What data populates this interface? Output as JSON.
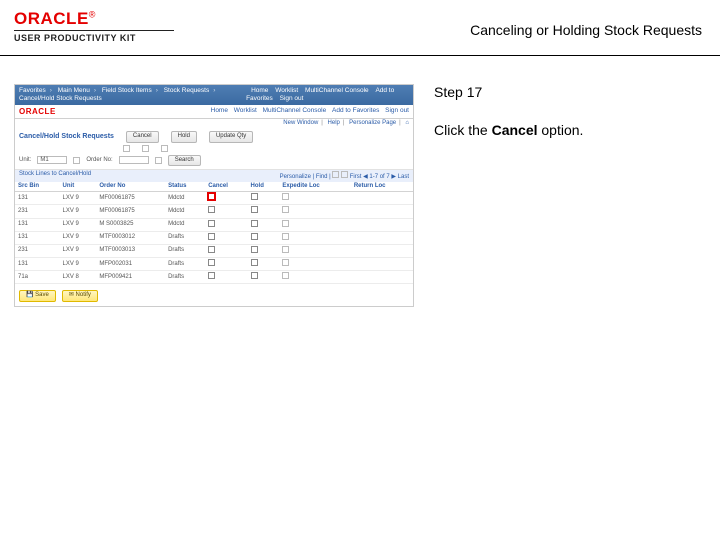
{
  "header": {
    "brand": "ORACLE",
    "brand_sub": "USER PRODUCTIVITY KIT",
    "doc_title": "Canceling or Holding Stock Requests"
  },
  "instructions": {
    "step_label": "Step 17",
    "line_pre": "Click the ",
    "line_bold": "Cancel",
    "line_post": " option."
  },
  "shot": {
    "crumb": {
      "items": [
        "Favorites",
        "Main Menu",
        "Field Stock Items",
        "Stock Requests",
        "Cancel/Hold Stock Requests"
      ],
      "right": [
        "Home",
        "Worklist",
        "MultiChannel Console",
        "Add to Favorites",
        "Sign out"
      ]
    },
    "mast": {
      "logo": "ORACLE",
      "links": [
        "Home",
        "Worklist",
        "MultiChannel Console",
        "Add to Favorites",
        "Sign out"
      ]
    },
    "util": [
      "New Window",
      "Help",
      "Personalize Page",
      "⌂"
    ],
    "page_title": "Cancel/Hold Stock Requests",
    "buttons": {
      "cancel": "Cancel",
      "hold": "Hold",
      "update_qty": "Update Qty"
    },
    "search": {
      "unit_lbl": "Unit:",
      "unit_val": "M1",
      "order_lbl": "Order No:",
      "go": "Search"
    },
    "table": {
      "header_bar_left": "Stock Lines to Cancel/Hold",
      "header_bar_right_prefix": "Personalize | Find |",
      "header_bar_right_suffix": "First ◀ 1-7 of 7 ▶ Last",
      "cols": [
        "Src Bin",
        "Unit",
        "Order No",
        "Status",
        "Cancel",
        "Hold",
        "Expedite Loc",
        "Return Loc"
      ],
      "rows": [
        {
          "c": [
            "131",
            "LXV 9",
            "MF00061875",
            "Mdctd"
          ],
          "cancel_hi": true,
          "hold": false
        },
        {
          "c": [
            "231",
            "LXV 9",
            "MF00061875",
            "Mdctd"
          ],
          "cancel_hi": false,
          "hold": false
        },
        {
          "c": [
            "131",
            "LXV 9",
            "M S0003825",
            "Mdctd"
          ],
          "cancel_hi": false,
          "hold": false
        },
        {
          "c": [
            "131",
            "LXV 9",
            "MTF0003012",
            "Drafts"
          ],
          "cancel_hi": false,
          "hold": false
        },
        {
          "c": [
            "231",
            "LXV 9",
            "MTF0003013",
            "Drafts"
          ],
          "cancel_hi": false,
          "hold": false
        },
        {
          "c": [
            "131",
            "LXV 9",
            "MFP002031",
            "Drafts"
          ],
          "cancel_hi": false,
          "hold": false
        },
        {
          "c": [
            "71a",
            "LXV 8",
            "MFP009421",
            "Drafts"
          ],
          "cancel_hi": false,
          "hold": false
        }
      ]
    },
    "footer": {
      "save": "Save",
      "notify": "Notify"
    }
  }
}
